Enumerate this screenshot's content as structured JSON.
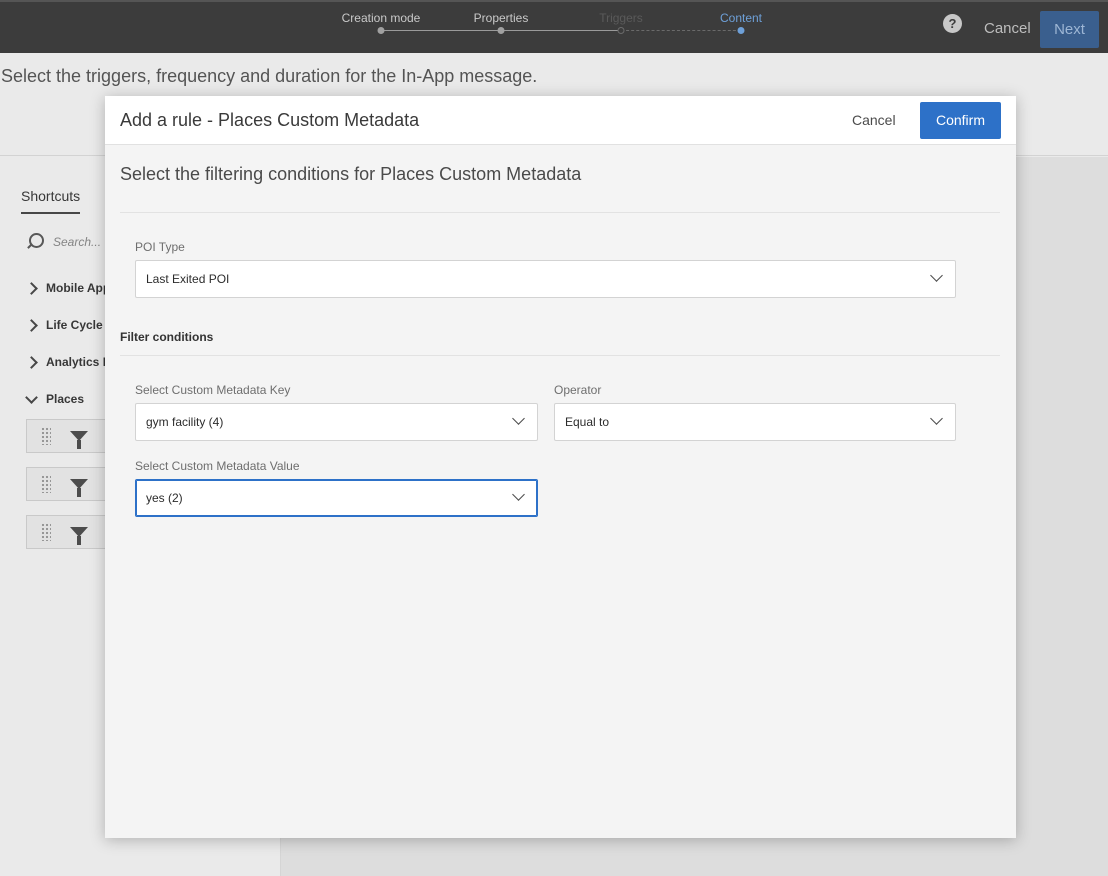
{
  "topbar": {
    "steps": [
      {
        "label": "Creation mode",
        "state": "done"
      },
      {
        "label": "Properties",
        "state": "done"
      },
      {
        "label": "Triggers",
        "state": "current"
      },
      {
        "label": "Content",
        "state": "upcoming"
      }
    ],
    "help_label": "?",
    "cancel_label": "Cancel",
    "next_label": "Next"
  },
  "page": {
    "subtitle": "Select the triggers, frequency and duration for the In-App message."
  },
  "sidebar": {
    "tab_label": "Shortcuts",
    "search_placeholder": "Search...",
    "items": [
      {
        "label": "Mobile App",
        "expanded": false
      },
      {
        "label": "Life Cycle E",
        "expanded": false
      },
      {
        "label": "Analytics E",
        "expanded": false
      },
      {
        "label": "Places",
        "expanded": true
      }
    ],
    "filter_cards": [
      "",
      "",
      ""
    ]
  },
  "modal": {
    "title": "Add a rule - Places Custom Metadata",
    "cancel_label": "Cancel",
    "confirm_label": "Confirm",
    "section_title": "Select the filtering conditions for Places Custom Metadata",
    "poi_type": {
      "label": "POI Type",
      "value": "Last Exited POI"
    },
    "filter_conditions_heading": "Filter conditions",
    "metadata_key": {
      "label": "Select Custom Metadata Key",
      "value": "gym facility (4)"
    },
    "operator": {
      "label": "Operator",
      "value": "Equal to"
    },
    "metadata_value": {
      "label": "Select Custom Metadata Value",
      "value": "yes (2)"
    }
  },
  "colors": {
    "accent": "#2d71c8",
    "topbar_bg": "#3c3c3c",
    "active_step": "#6ea0d8"
  }
}
